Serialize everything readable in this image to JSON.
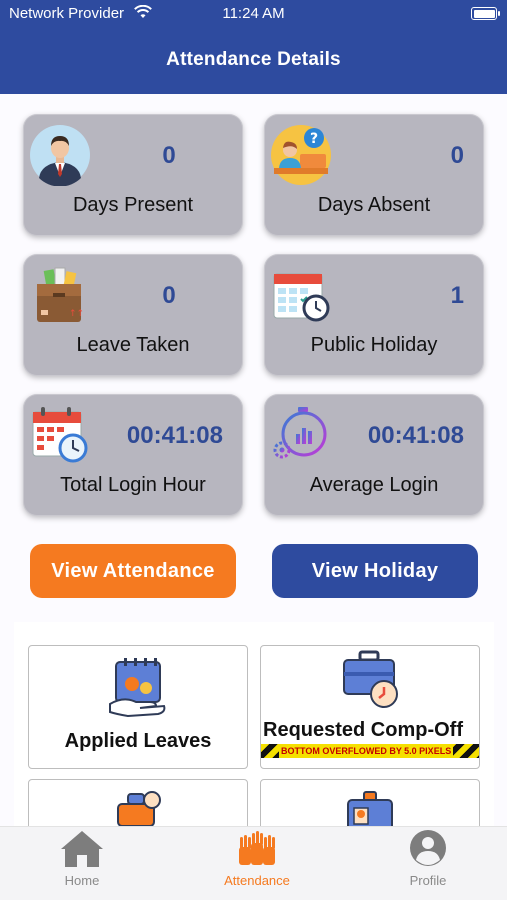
{
  "status_bar": {
    "carrier": "Network Provider",
    "time": "11:24 AM"
  },
  "header": {
    "title": "Attendance Details"
  },
  "stats": {
    "days_present": {
      "label": "Days Present",
      "value": "0"
    },
    "days_absent": {
      "label": "Days Absent",
      "value": "0"
    },
    "leave_taken": {
      "label": "Leave Taken",
      "value": "0"
    },
    "public_holiday": {
      "label": "Public Holiday",
      "value": "1"
    },
    "total_login_hour": {
      "label": "Total Login Hour",
      "value": "00:41:08"
    },
    "average_login": {
      "label": "Average Login",
      "value": "00:41:08"
    }
  },
  "buttons": {
    "view_attendance": "View Attendance",
    "view_holiday": "View Holiday"
  },
  "tiles": {
    "applied_leaves": "Applied Leaves",
    "requested_compoff": "Requested Comp-Off",
    "overflow_warning": "BOTTOM OVERFLOWED BY 5.0 PIXELS"
  },
  "bottom_nav": {
    "home": "Home",
    "attendance": "Attendance",
    "profile": "Profile"
  },
  "colors": {
    "primary": "#2e4b9f",
    "accent": "#f57a20",
    "card": "#b7b6bf",
    "value_text": "#2f4a95"
  }
}
